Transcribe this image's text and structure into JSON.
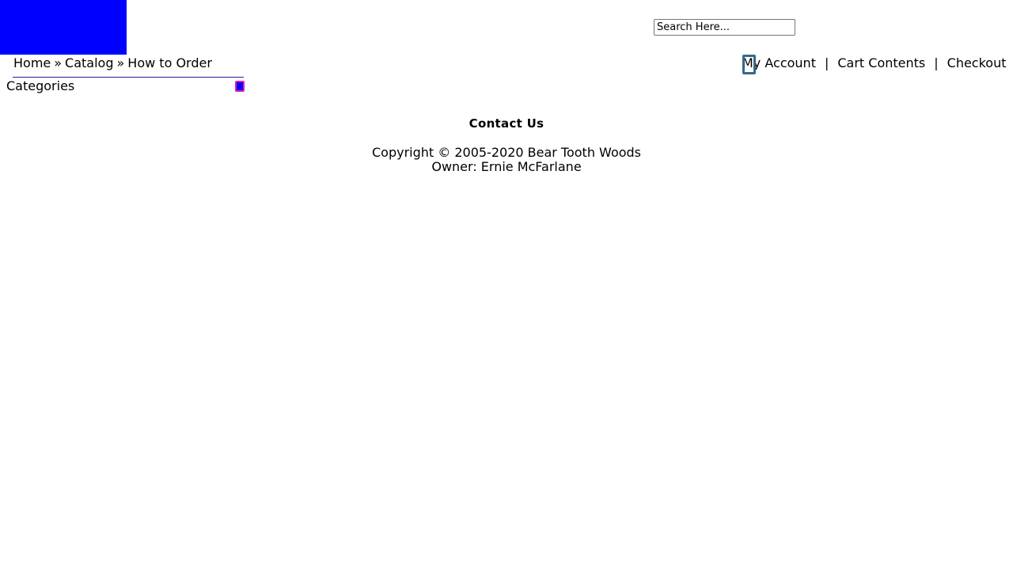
{
  "colors": {
    "logo": "#0000ff",
    "categories_line": "#2b1d8f",
    "toggle_fill": "#0000ff"
  },
  "header": {
    "search": {
      "placeholder": "Search Here..."
    },
    "breadcrumb": {
      "items": [
        "Home",
        "Catalog",
        "How to Order"
      ],
      "separator": "»"
    },
    "links": {
      "my_account": "My Account",
      "cart_contents": "Cart Contents",
      "checkout": "Checkout",
      "separator": "|"
    }
  },
  "sidebar": {
    "categories_title": "Categories"
  },
  "footer": {
    "contact": "Contact Us",
    "copyright": "Copyright © 2005-2020 Bear Tooth Woods",
    "owner": "Owner: Ernie McFarlane"
  }
}
